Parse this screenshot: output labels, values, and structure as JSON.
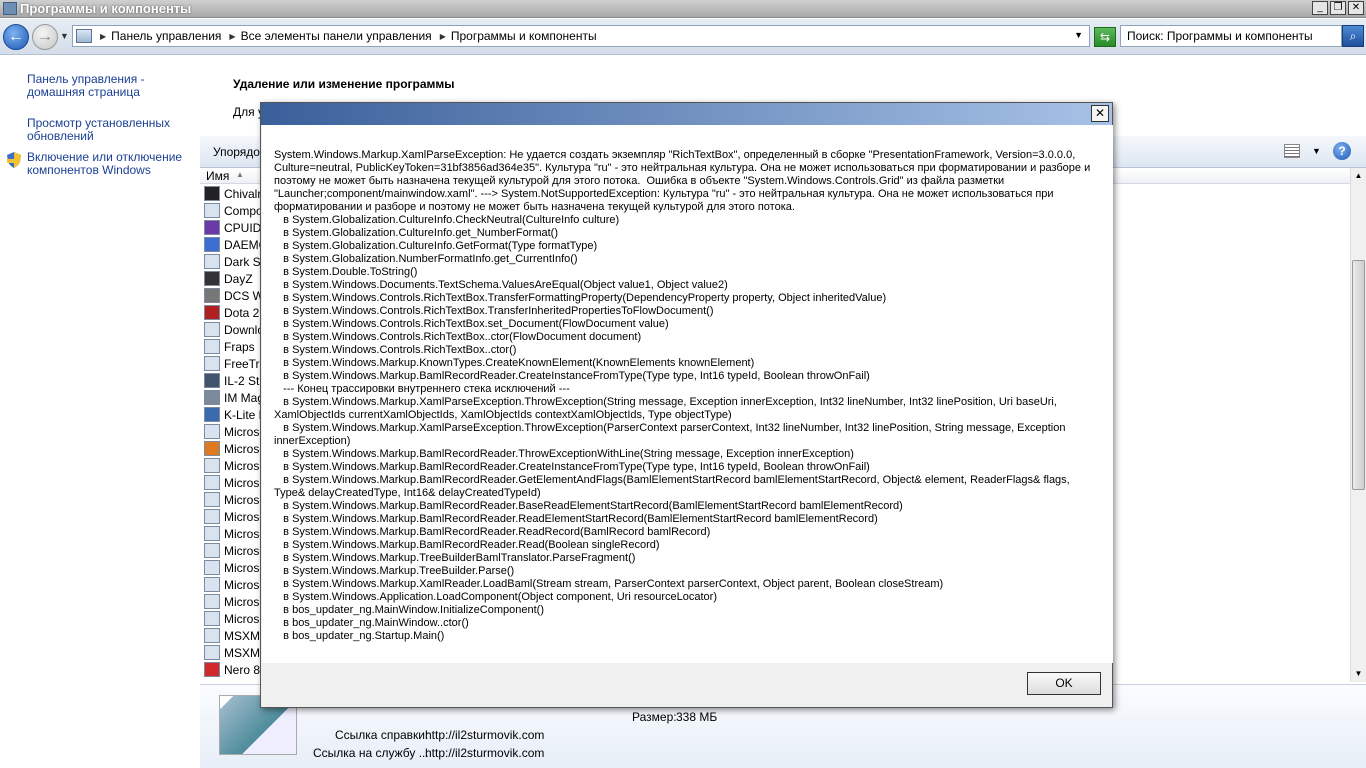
{
  "window": {
    "title": "Программы и компоненты",
    "min": "_",
    "restore": "❐",
    "close": "✕"
  },
  "address": {
    "crumbs": [
      "Панель управления",
      "Все элементы панели управления",
      "Программы и компоненты"
    ],
    "search_text": "Поиск: Программы и компоненты"
  },
  "sidebar": {
    "items": [
      {
        "label": "Панель управления - домашняя страница"
      },
      {
        "label": "Просмотр установленных обновлений"
      },
      {
        "label": "Включение или отключение компонентов Windows"
      }
    ]
  },
  "main": {
    "heading": "Удаление или изменение программы",
    "desc": "Для у"
  },
  "toolbar": {
    "organize": "Упорядоч"
  },
  "list": {
    "column": "Имя",
    "programs": [
      {
        "name": "Chivalr",
        "color": "#222222"
      },
      {
        "name": "Compor",
        "color": "#d9e3ef"
      },
      {
        "name": "CPUID",
        "color": "#6a3aa8"
      },
      {
        "name": "DAEMC",
        "color": "#3b6fd1"
      },
      {
        "name": "Dark Sc",
        "color": "#d9e3ef"
      },
      {
        "name": "DayZ",
        "color": "#333333"
      },
      {
        "name": "DCS Wo",
        "color": "#777777"
      },
      {
        "name": "Dota 2",
        "color": "#b02020"
      },
      {
        "name": "Downlo",
        "color": "#d9e3ef"
      },
      {
        "name": "Fraps",
        "color": "#d9e3ef"
      },
      {
        "name": "FreeTra",
        "color": "#d9e3ef"
      },
      {
        "name": "IL-2 Stu",
        "color": "#41546e"
      },
      {
        "name": "IM Mag",
        "color": "#7a8a9a"
      },
      {
        "name": "K-Lite N",
        "color": "#3a6ab0"
      },
      {
        "name": "Microsc",
        "color": "#d9e3ef"
      },
      {
        "name": "Microsc",
        "color": "#e07a20"
      },
      {
        "name": "Microsc",
        "color": "#d9e3ef"
      },
      {
        "name": "Microsc",
        "color": "#d9e3ef"
      },
      {
        "name": "Microsc",
        "color": "#d9e3ef"
      },
      {
        "name": "Microsc",
        "color": "#d9e3ef"
      },
      {
        "name": "Microsc",
        "color": "#d9e3ef"
      },
      {
        "name": "Microsc",
        "color": "#d9e3ef"
      },
      {
        "name": "Microsc",
        "color": "#d9e3ef"
      },
      {
        "name": "Microsc",
        "color": "#d9e3ef"
      },
      {
        "name": "Microsc",
        "color": "#d9e3ef"
      },
      {
        "name": "Microsc",
        "color": "#d9e3ef"
      },
      {
        "name": "MSXML",
        "color": "#d9e3ef"
      },
      {
        "name": "MSXML",
        "color": "#d9e3ef"
      },
      {
        "name": "Nero 8",
        "color": "#d02a2a"
      }
    ]
  },
  "details": {
    "size_label": "Размер:",
    "size_value": "338 МБ",
    "help_label": "Ссылка справки:",
    "help_value": "http://il2sturmovik.com",
    "support_label": "Ссылка на службу ...",
    "support_value": "http://il2sturmovik.com"
  },
  "dialog": {
    "close": "✕",
    "ok": "OK",
    "message": "System.Windows.Markup.XamlParseException: Не удается создать экземпляр \"RichTextBox\", определенный в сборке \"PresentationFramework, Version=3.0.0.0, Culture=neutral, PublicKeyToken=31bf3856ad364e35\". Культура \"ru\" - это нейтральная культура. Она не может использоваться при форматировании и разборе и поэтому не может быть назначена текущей культурой для этого потока.  Ошибка в объекте \"System.Windows.Controls.Grid\" из файла разметки \"Launcher;component/mainwindow.xaml\". ---> System.NotSupportedException: Культура \"ru\" - это нейтральная культура. Она не может использоваться при форматировании и разборе и поэтому не может быть назначена текущей культурой для этого потока.\n   в System.Globalization.CultureInfo.CheckNeutral(CultureInfo culture)\n   в System.Globalization.CultureInfo.get_NumberFormat()\n   в System.Globalization.CultureInfo.GetFormat(Type formatType)\n   в System.Globalization.NumberFormatInfo.get_CurrentInfo()\n   в System.Double.ToString()\n   в System.Windows.Documents.TextSchema.ValuesAreEqual(Object value1, Object value2)\n   в System.Windows.Controls.RichTextBox.TransferFormattingProperty(DependencyProperty property, Object inheritedValue)\n   в System.Windows.Controls.RichTextBox.TransferInheritedPropertiesToFlowDocument()\n   в System.Windows.Controls.RichTextBox.set_Document(FlowDocument value)\n   в System.Windows.Controls.RichTextBox..ctor(FlowDocument document)\n   в System.Windows.Controls.RichTextBox..ctor()\n   в System.Windows.Markup.KnownTypes.CreateKnownElement(KnownElements knownElement)\n   в System.Windows.Markup.BamlRecordReader.CreateInstanceFromType(Type type, Int16 typeId, Boolean throwOnFail)\n   --- Конец трассировки внутреннего стека исключений ---\n   в System.Windows.Markup.XamlParseException.ThrowException(String message, Exception innerException, Int32 lineNumber, Int32 linePosition, Uri baseUri, XamlObjectIds currentXamlObjectIds, XamlObjectIds contextXamlObjectIds, Type objectType)\n   в System.Windows.Markup.XamlParseException.ThrowException(ParserContext parserContext, Int32 lineNumber, Int32 linePosition, String message, Exception innerException)\n   в System.Windows.Markup.BamlRecordReader.ThrowExceptionWithLine(String message, Exception innerException)\n   в System.Windows.Markup.BamlRecordReader.CreateInstanceFromType(Type type, Int16 typeId, Boolean throwOnFail)\n   в System.Windows.Markup.BamlRecordReader.GetElementAndFlags(BamlElementStartRecord bamlElementStartRecord, Object& element, ReaderFlags& flags, Type& delayCreatedType, Int16& delayCreatedTypeId)\n   в System.Windows.Markup.BamlRecordReader.BaseReadElementStartRecord(BamlElementStartRecord bamlElementRecord)\n   в System.Windows.Markup.BamlRecordReader.ReadElementStartRecord(BamlElementStartRecord bamlElementRecord)\n   в System.Windows.Markup.BamlRecordReader.ReadRecord(BamlRecord bamlRecord)\n   в System.Windows.Markup.BamlRecordReader.Read(Boolean singleRecord)\n   в System.Windows.Markup.TreeBuilderBamlTranslator.ParseFragment()\n   в System.Windows.Markup.TreeBuilder.Parse()\n   в System.Windows.Markup.XamlReader.LoadBaml(Stream stream, ParserContext parserContext, Object parent, Boolean closeStream)\n   в System.Windows.Application.LoadComponent(Object component, Uri resourceLocator)\n   в bos_updater_ng.MainWindow.InitializeComponent()\n   в bos_updater_ng.MainWindow..ctor()\n   в bos_updater_ng.Startup.Main()"
  }
}
